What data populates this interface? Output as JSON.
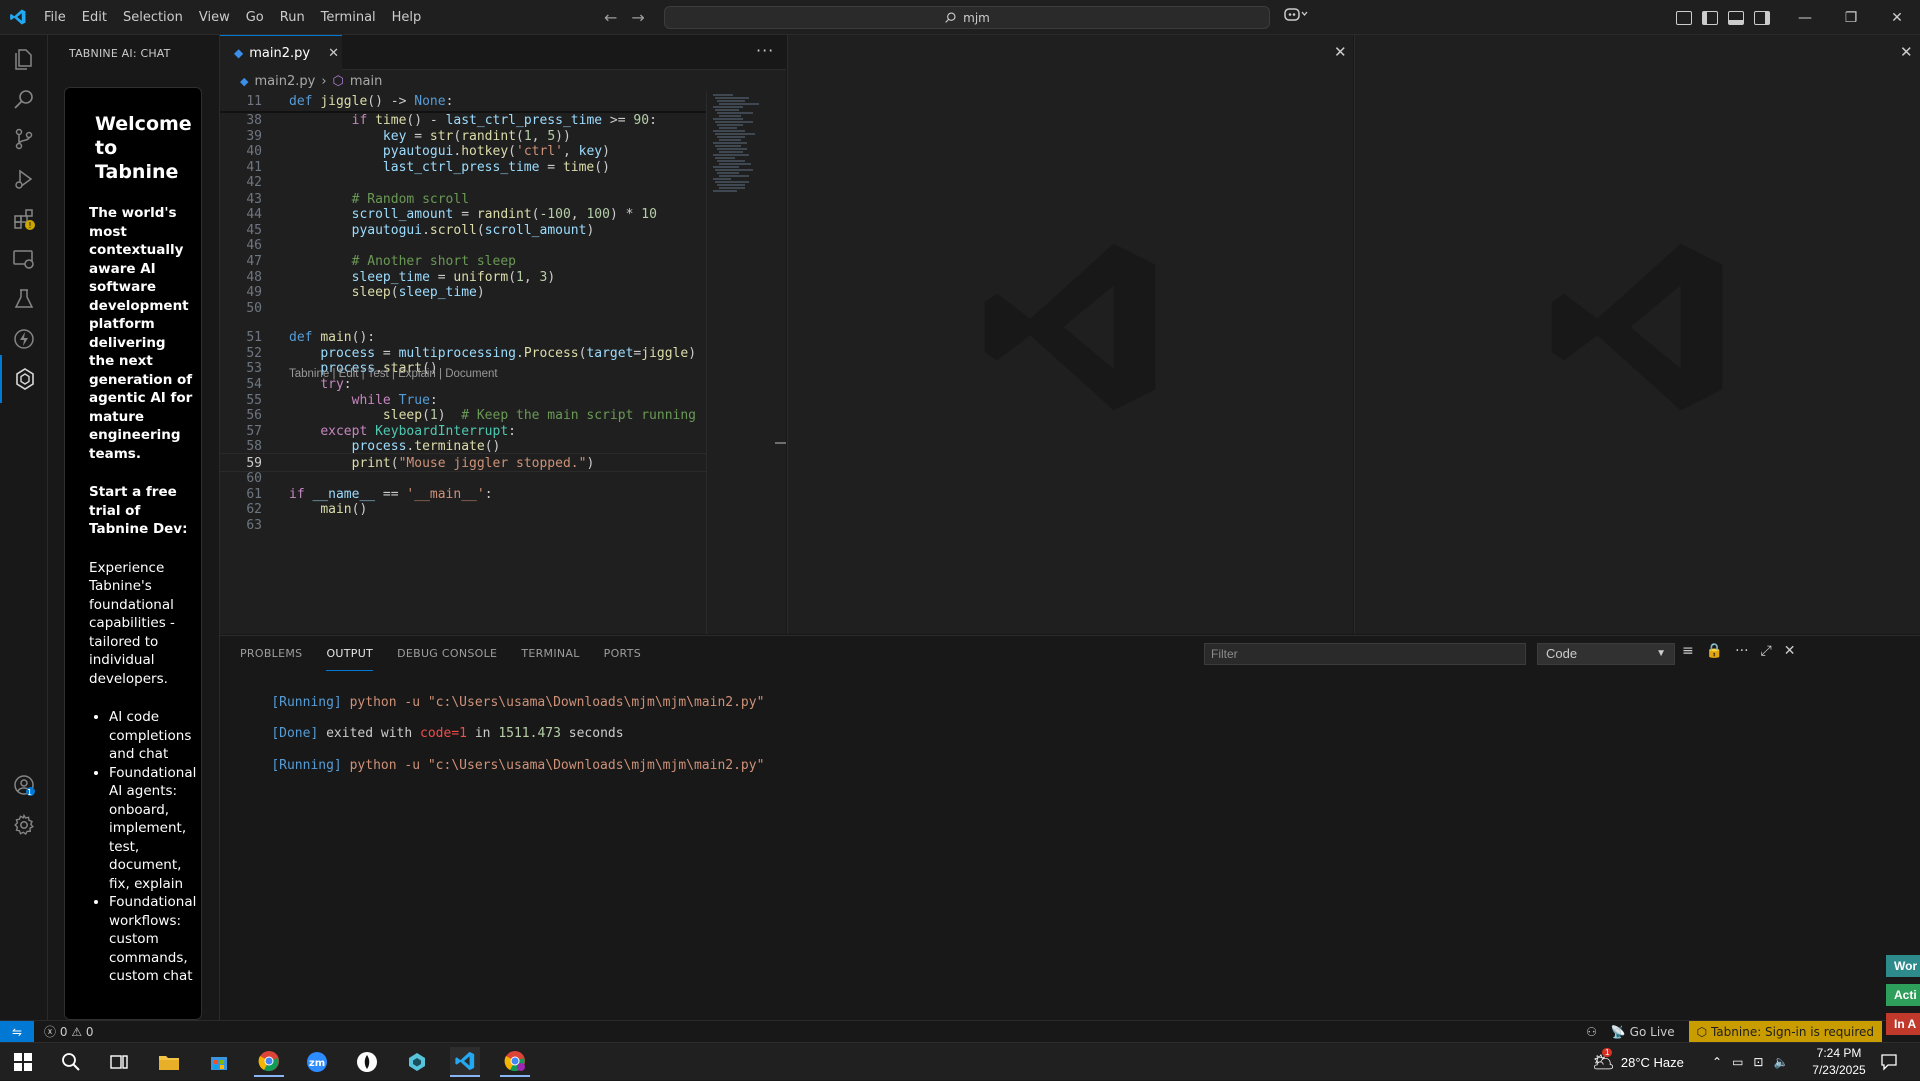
{
  "menu": [
    "File",
    "Edit",
    "Selection",
    "View",
    "Go",
    "Run",
    "Terminal",
    "Help"
  ],
  "search": {
    "text": "mjm"
  },
  "sidebar": {
    "title": "TABNINE AI: CHAT",
    "welcome_title": "Welcome to Tabnine",
    "tagline": "The world's most contextually aware AI software development platform delivering the next generation of agentic AI for mature engineering teams.",
    "trial_heading": "Start a free trial of Tabnine Dev:",
    "description": "Experience Tabnine's foundational capabilities - tailored to individual developers.",
    "bullets": [
      "AI code completions and chat",
      "Foundational AI agents: onboard, implement, test, document, fix, explain",
      "Foundational workflows: custom commands, custom chat"
    ]
  },
  "editor": {
    "tab_label": "main2.py",
    "breadcrumb_file": "main2.py",
    "breadcrumb_symbol": "main",
    "codelens": "Tabnine | Edit | Test | Explain | Document",
    "lines": [
      {
        "n": "11",
        "code": "def jiggle() -> None:"
      },
      {
        "n": "38",
        "code": "        if time() - last_ctrl_press_time >= 90:"
      },
      {
        "n": "39",
        "code": "            key = str(randint(1, 5))"
      },
      {
        "n": "40",
        "code": "            pyautogui.hotkey('ctrl', key)"
      },
      {
        "n": "41",
        "code": "            last_ctrl_press_time = time()"
      },
      {
        "n": "42",
        "code": ""
      },
      {
        "n": "43",
        "code": "        # Random scroll"
      },
      {
        "n": "44",
        "code": "        scroll_amount = randint(-100, 100) * 10"
      },
      {
        "n": "45",
        "code": "        pyautogui.scroll(scroll_amount)"
      },
      {
        "n": "46",
        "code": ""
      },
      {
        "n": "47",
        "code": "        # Another short sleep"
      },
      {
        "n": "48",
        "code": "        sleep_time = uniform(1, 3)"
      },
      {
        "n": "49",
        "code": "        sleep(sleep_time)"
      },
      {
        "n": "50",
        "code": ""
      },
      {
        "n": "51",
        "code": "def main():"
      },
      {
        "n": "52",
        "code": "    process = multiprocessing.Process(target=jiggle)"
      },
      {
        "n": "53",
        "code": "    process.start()"
      },
      {
        "n": "54",
        "code": "    try:"
      },
      {
        "n": "55",
        "code": "        while True:"
      },
      {
        "n": "56",
        "code": "            sleep(1)  # Keep the main script running"
      },
      {
        "n": "57",
        "code": "    except KeyboardInterrupt:"
      },
      {
        "n": "58",
        "code": "        process.terminate()"
      },
      {
        "n": "59",
        "code": "        print(\"Mouse jiggler stopped.\")"
      },
      {
        "n": "60",
        "code": ""
      },
      {
        "n": "61",
        "code": "if __name__ == '__main__':"
      },
      {
        "n": "62",
        "code": "    main()"
      },
      {
        "n": "63",
        "code": ""
      }
    ]
  },
  "panel": {
    "tabs": [
      "PROBLEMS",
      "OUTPUT",
      "DEBUG CONSOLE",
      "TERMINAL",
      "PORTS"
    ],
    "active_tab": "OUTPUT",
    "filter_placeholder": "Filter",
    "channel": "Code",
    "output": {
      "run1_tag": "[Running]",
      "run1_cmd": "python -u \"c:\\Users\\usama\\Downloads\\mjm\\mjm\\main2.py\"",
      "done_tag": "[Done]",
      "done_text1": "exited with",
      "done_code": "code=1",
      "done_text2": "in",
      "done_time": "1511.473",
      "done_text3": "seconds",
      "run2_tag": "[Running]",
      "run2_cmd": "python -u \"c:\\Users\\usama\\Downloads\\mjm\\mjm\\main2.py\""
    }
  },
  "status": {
    "problems": "0",
    "warnings": "0",
    "go_live": "Go Live",
    "tabnine": "Tabnine: Sign-in is required"
  },
  "edge_tabs": [
    {
      "label": "Wor",
      "color": "#2e8b8b"
    },
    {
      "label": "Acti",
      "color": "#2e9e5b"
    },
    {
      "label": "In A",
      "color": "#c0392b"
    }
  ],
  "taskbar": {
    "weather": "28°C  Haze",
    "time": "7:24 PM",
    "date": "7/23/2025",
    "weather_badge": "1"
  },
  "accounts_badge": "1"
}
